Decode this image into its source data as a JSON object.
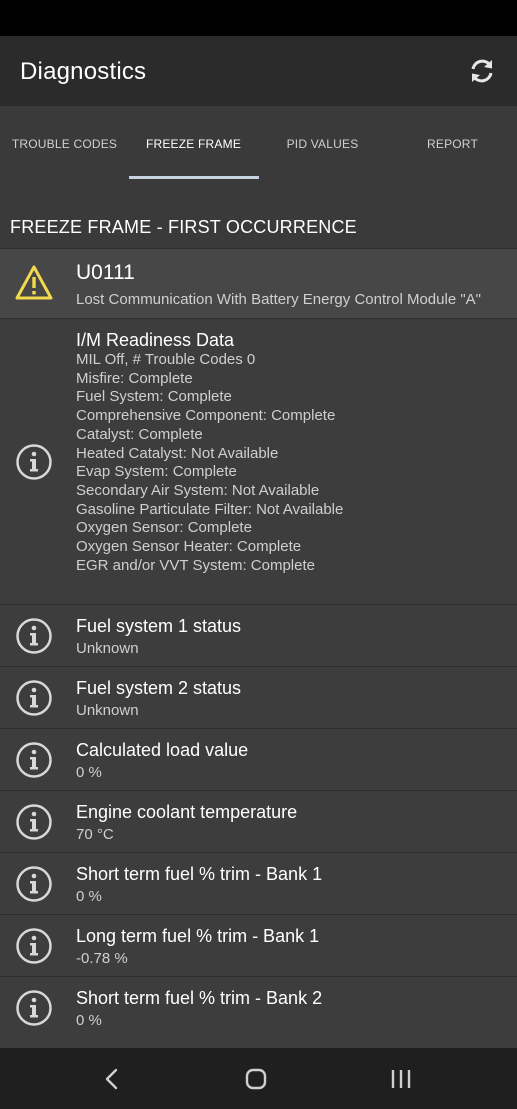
{
  "app_bar": {
    "title": "Diagnostics",
    "refresh_icon": "refresh-icon"
  },
  "tabs": [
    {
      "label": "TROUBLE CODES",
      "active": false
    },
    {
      "label": "FREEZE FRAME",
      "active": true
    },
    {
      "label": "PID VALUES",
      "active": false
    },
    {
      "label": "REPORT",
      "active": false
    }
  ],
  "section_header": "FREEZE FRAME - FIRST OCCURRENCE",
  "trouble_code": {
    "code": "U0111",
    "description": "Lost Communication With Battery Energy Control Module \"A\"",
    "icon": "warning-icon"
  },
  "readiness": {
    "title": "I/M Readiness Data",
    "lines": [
      "MIL Off, # Trouble Codes 0",
      "Misfire: Complete",
      "Fuel System: Complete",
      "Comprehensive Component: Complete",
      "Catalyst: Complete",
      "Heated Catalyst: Not Available",
      "Evap System: Complete",
      "Secondary Air System: Not Available",
      "Gasoline Particulate Filter: Not Available",
      "Oxygen Sensor: Complete",
      "Oxygen Sensor Heater: Complete",
      "EGR and/or VVT System: Complete"
    ]
  },
  "pids": [
    {
      "title": "Fuel system 1 status",
      "value": "Unknown"
    },
    {
      "title": "Fuel system 2 status",
      "value": "Unknown"
    },
    {
      "title": "Calculated load value",
      "value": "0 %"
    },
    {
      "title": "Engine coolant temperature",
      "value": "70 °C"
    },
    {
      "title": "Short term fuel % trim - Bank 1",
      "value": "0 %"
    },
    {
      "title": "Long term fuel % trim - Bank 1",
      "value": "-0.78 %"
    },
    {
      "title": "Short term fuel % trim - Bank 2",
      "value": "0 %"
    }
  ],
  "nav": {
    "back_icon": "back-icon",
    "home_icon": "home-icon",
    "recents_icon": "recents-icon"
  },
  "colors": {
    "accent": "#c7d2e0",
    "warning": "#f2d94e",
    "background": "#3a3a3a"
  }
}
